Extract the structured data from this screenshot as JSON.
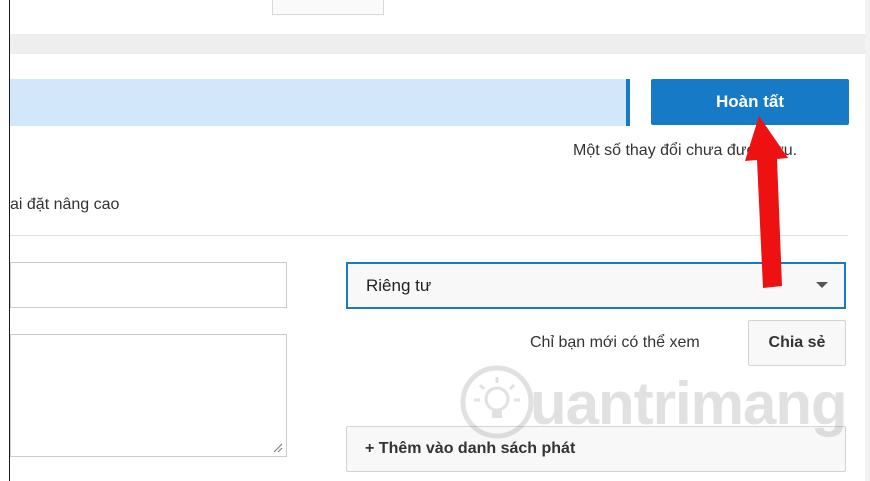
{
  "header": {
    "done_label": "Hoàn tất",
    "save_status": "Một số thay đổi chưa được lưu."
  },
  "upload": {
    "progress_percent": 100
  },
  "tabs": {
    "advanced_label": "ai đặt nâng cao"
  },
  "form": {
    "title_value": "",
    "description_value": "",
    "privacy_value": "Riêng tư",
    "privacy_hint": "Chỉ bạn mới có thể xem",
    "share_label": "Chia sẻ",
    "playlist_label": "+ Thêm vào danh sách phát"
  },
  "watermark": {
    "text": "uantrimang"
  },
  "colors": {
    "accent": "#167ac6",
    "progress_fill": "#d3e7fb",
    "annotation_arrow": "#ee1111"
  },
  "icons": {
    "chevron": "chevron-down-icon",
    "resize": "resize-handle-icon",
    "annotation": "red-arrow-annotation",
    "watermark_logo": "lightbulb-logo"
  }
}
